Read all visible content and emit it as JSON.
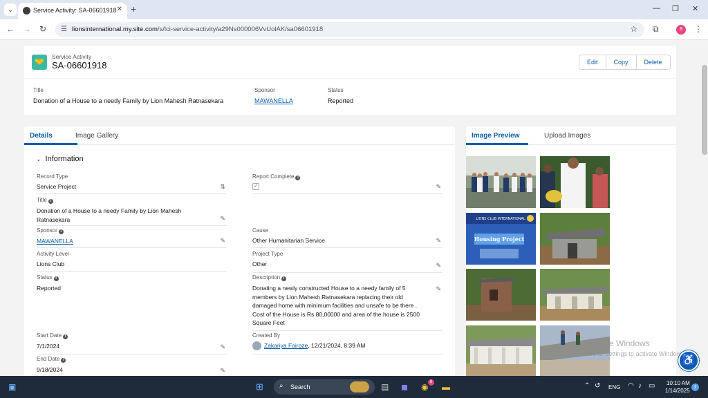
{
  "browser": {
    "tab_title": "Service Activity: SA-06601918",
    "tab_close": "✕",
    "new_tab": "+",
    "url_host": "lionsinternational.my.site.com",
    "url_path": "/s/lci-service-activity/a29Ns000006VvUolAK/sa06601918",
    "profile_initial": "8"
  },
  "record": {
    "object_type": "Service Activity",
    "name": "SA-06601918",
    "actions": [
      "Edit",
      "Copy",
      "Delete"
    ]
  },
  "highlights": [
    {
      "label": "Title",
      "value": "Donation of a House to a needy Family by Lion Mahesh Ratnasekara"
    },
    {
      "label": "Sponsor",
      "value": "MAWANELLA"
    },
    {
      "label": "Status",
      "value": "Reported"
    }
  ],
  "detail_tabs": [
    "Details",
    "Image Gallery"
  ],
  "section_title": "Information",
  "fields": {
    "record_type": {
      "label": "Record Type",
      "value": "Service Project"
    },
    "report_complete": {
      "label": "Report Complete",
      "value": "✓"
    },
    "title": {
      "label": "Title",
      "value": "Donation of a House to a needy Family by Lion Mahesh Ratnasekara"
    },
    "sponsor": {
      "label": "Sponsor",
      "value": "MAWANELLA"
    },
    "cause": {
      "label": "Cause",
      "value": "Other Humanitarian Service"
    },
    "activity_level": {
      "label": "Activity Level",
      "value": "Lions Club"
    },
    "project_type": {
      "label": "Project Type",
      "value": "Other"
    },
    "status": {
      "label": "Status",
      "value": "Reported"
    },
    "description": {
      "label": "Description",
      "value": "Donating a newly constructed House to a needy family of 5 members by Lion Mahesh Ratnasekara replacing their old damaged home with minimum facilities and unsafe to be there . Cost of the House is Rs 80,00000 and area of the house is 2500 Square Feet"
    },
    "start_date": {
      "label": "Start Date",
      "value": "7/1/2024"
    },
    "created_by": {
      "label": "Created By",
      "user": "Zakariya Fairoze",
      "date": ", 12/21/2024, 8:39 AM"
    },
    "end_date": {
      "label": "End Date",
      "value": "9/18/2024"
    }
  },
  "image_tabs": [
    "Image Preview",
    "Upload Images"
  ],
  "gallery": {
    "poster_line1": "LIONS CLUB INTERNATIONAL",
    "poster_title": "Housing Project"
  },
  "watermark": {
    "line1": "Activate Windows",
    "line2": "Go to Settings to activate Windows."
  },
  "taskbar": {
    "search": "Search",
    "language": "ENG",
    "time": "10:10 AM",
    "date": "1/14/2025",
    "notifications": "1",
    "chrome_badge": "8"
  },
  "icons": [
    "window-menu-icon",
    "globe-favicon-icon",
    "back-icon",
    "forward-icon",
    "reload-icon",
    "site-info-icon",
    "star-icon",
    "extensions-icon",
    "kebab-icon",
    "handshake-icon",
    "pencil-icon",
    "swap-icon",
    "chevron-down-icon",
    "info-icon",
    "accessibility-icon",
    "windows-start-icon",
    "search-icon",
    "wifi-icon",
    "volume-icon",
    "battery-icon"
  ]
}
